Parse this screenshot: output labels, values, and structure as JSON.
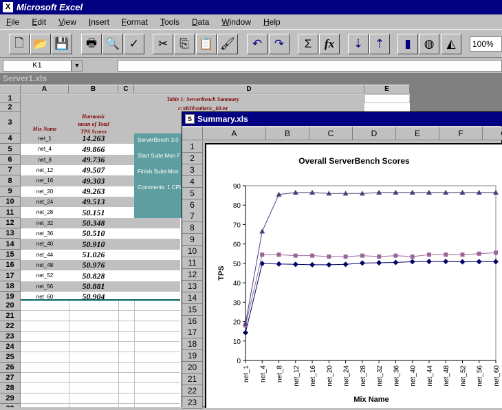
{
  "app": {
    "title": "Microsoft Excel",
    "icon": "excel-icon"
  },
  "menu": [
    "File",
    "Edit",
    "View",
    "Insert",
    "Format",
    "Tools",
    "Data",
    "Window",
    "Help"
  ],
  "toolbar": {
    "buttons": [
      "new-icon",
      "open-icon",
      "save-icon",
      "print-icon",
      "print-preview-icon",
      "spelling-icon",
      "cut-icon",
      "copy-icon",
      "paste-icon",
      "format-painter-icon",
      "undo-icon",
      "redo-icon",
      "autosum-icon",
      "function-wizard-icon",
      "sort-ascending-icon",
      "sort-descending-icon",
      "chart-wizard-icon",
      "map-icon",
      "drawing-icon"
    ],
    "autosum_glyph": "Σ",
    "fx_glyph": "fx",
    "zoom": "100%"
  },
  "formula_bar": {
    "name_box": "K1",
    "content": ""
  },
  "wb1": {
    "title": "Server1.xls",
    "columns": [
      "A",
      "B",
      "C",
      "D",
      "E"
    ],
    "table_title": "Table 1: ServerBench Summary",
    "table_subtitle": "c:\\sb30\\suites\\c_60.tst",
    "header_a": "Mix Name",
    "header_b_lines": [
      "Harmonic",
      "mean of Total",
      "TPS Scores"
    ],
    "info": [
      "ServerBench 3.0",
      "Start Suite:Mon F",
      "Finish Suite:Mon",
      "Comments: 1 CPU"
    ],
    "data": [
      {
        "row": "4",
        "mix": "net_1",
        "tps": "14.263"
      },
      {
        "row": "5",
        "mix": "net_4",
        "tps": "49.866"
      },
      {
        "row": "6",
        "mix": "net_8",
        "tps": "49.736"
      },
      {
        "row": "7",
        "mix": "net_12",
        "tps": "49.507"
      },
      {
        "row": "8",
        "mix": "net_16",
        "tps": "49.303"
      },
      {
        "row": "9",
        "mix": "net_20",
        "tps": "49.263"
      },
      {
        "row": "10",
        "mix": "net_24",
        "tps": "49.513"
      },
      {
        "row": "11",
        "mix": "net_28",
        "tps": "50.151"
      },
      {
        "row": "12",
        "mix": "net_32",
        "tps": "50.348"
      },
      {
        "row": "13",
        "mix": "net_36",
        "tps": "50.510"
      },
      {
        "row": "14",
        "mix": "net_40",
        "tps": "50.910"
      },
      {
        "row": "15",
        "mix": "net_44",
        "tps": "51.026"
      },
      {
        "row": "16",
        "mix": "net_48",
        "tps": "50.976"
      },
      {
        "row": "17",
        "mix": "net_52",
        "tps": "50.828"
      },
      {
        "row": "18",
        "mix": "net_56",
        "tps": "50.881"
      },
      {
        "row": "19",
        "mix": "net_60",
        "tps": "50.904"
      }
    ],
    "empty_rows": [
      "20",
      "21",
      "22",
      "23",
      "24",
      "25",
      "26",
      "27",
      "28",
      "29",
      "30"
    ]
  },
  "wb2": {
    "title": "Summary.xls",
    "columns": [
      "A",
      "B",
      "C",
      "D",
      "E",
      "F",
      "G"
    ],
    "rows": [
      "1",
      "2",
      "3",
      "4",
      "5",
      "6",
      "7",
      "8",
      "9",
      "10",
      "11",
      "12",
      "13",
      "14",
      "15",
      "16",
      "17",
      "18",
      "19",
      "20",
      "21",
      "22",
      "23"
    ]
  },
  "chart_data": {
    "type": "line",
    "title": "Overall ServerBench Scores",
    "xlabel": "Mix Name",
    "ylabel": "TPS",
    "ylim": [
      0,
      90
    ],
    "yticks": [
      0,
      10,
      20,
      30,
      40,
      50,
      60,
      70,
      80,
      90
    ],
    "categories": [
      "net_1",
      "net_4",
      "net_8",
      "net_12",
      "net_16",
      "net_20",
      "net_24",
      "net_28",
      "net_32",
      "net_36",
      "net_40",
      "net_44",
      "net_48",
      "net_52",
      "net_56",
      "net_60"
    ],
    "grid": false,
    "series": [
      {
        "color": "#000066",
        "marker": "diamond",
        "values": [
          14.3,
          49.9,
          49.7,
          49.5,
          49.3,
          49.3,
          49.5,
          50.2,
          50.3,
          50.5,
          50.9,
          51.0,
          51.0,
          50.8,
          50.9,
          50.9
        ]
      },
      {
        "color": "#996699",
        "marker": "square",
        "values": [
          18,
          54.5,
          54.5,
          54,
          54,
          53.5,
          53.5,
          54,
          53.5,
          54,
          53.5,
          54.5,
          54.5,
          54.5,
          55,
          55.5
        ]
      },
      {
        "color": "#4b3b7a",
        "marker": "triangle",
        "values": [
          19,
          66.5,
          85.5,
          86.5,
          86.5,
          86,
          86,
          86,
          86.5,
          86.5,
          86.5,
          86.5,
          86.5,
          86.5,
          86.5,
          86.5
        ]
      }
    ]
  }
}
